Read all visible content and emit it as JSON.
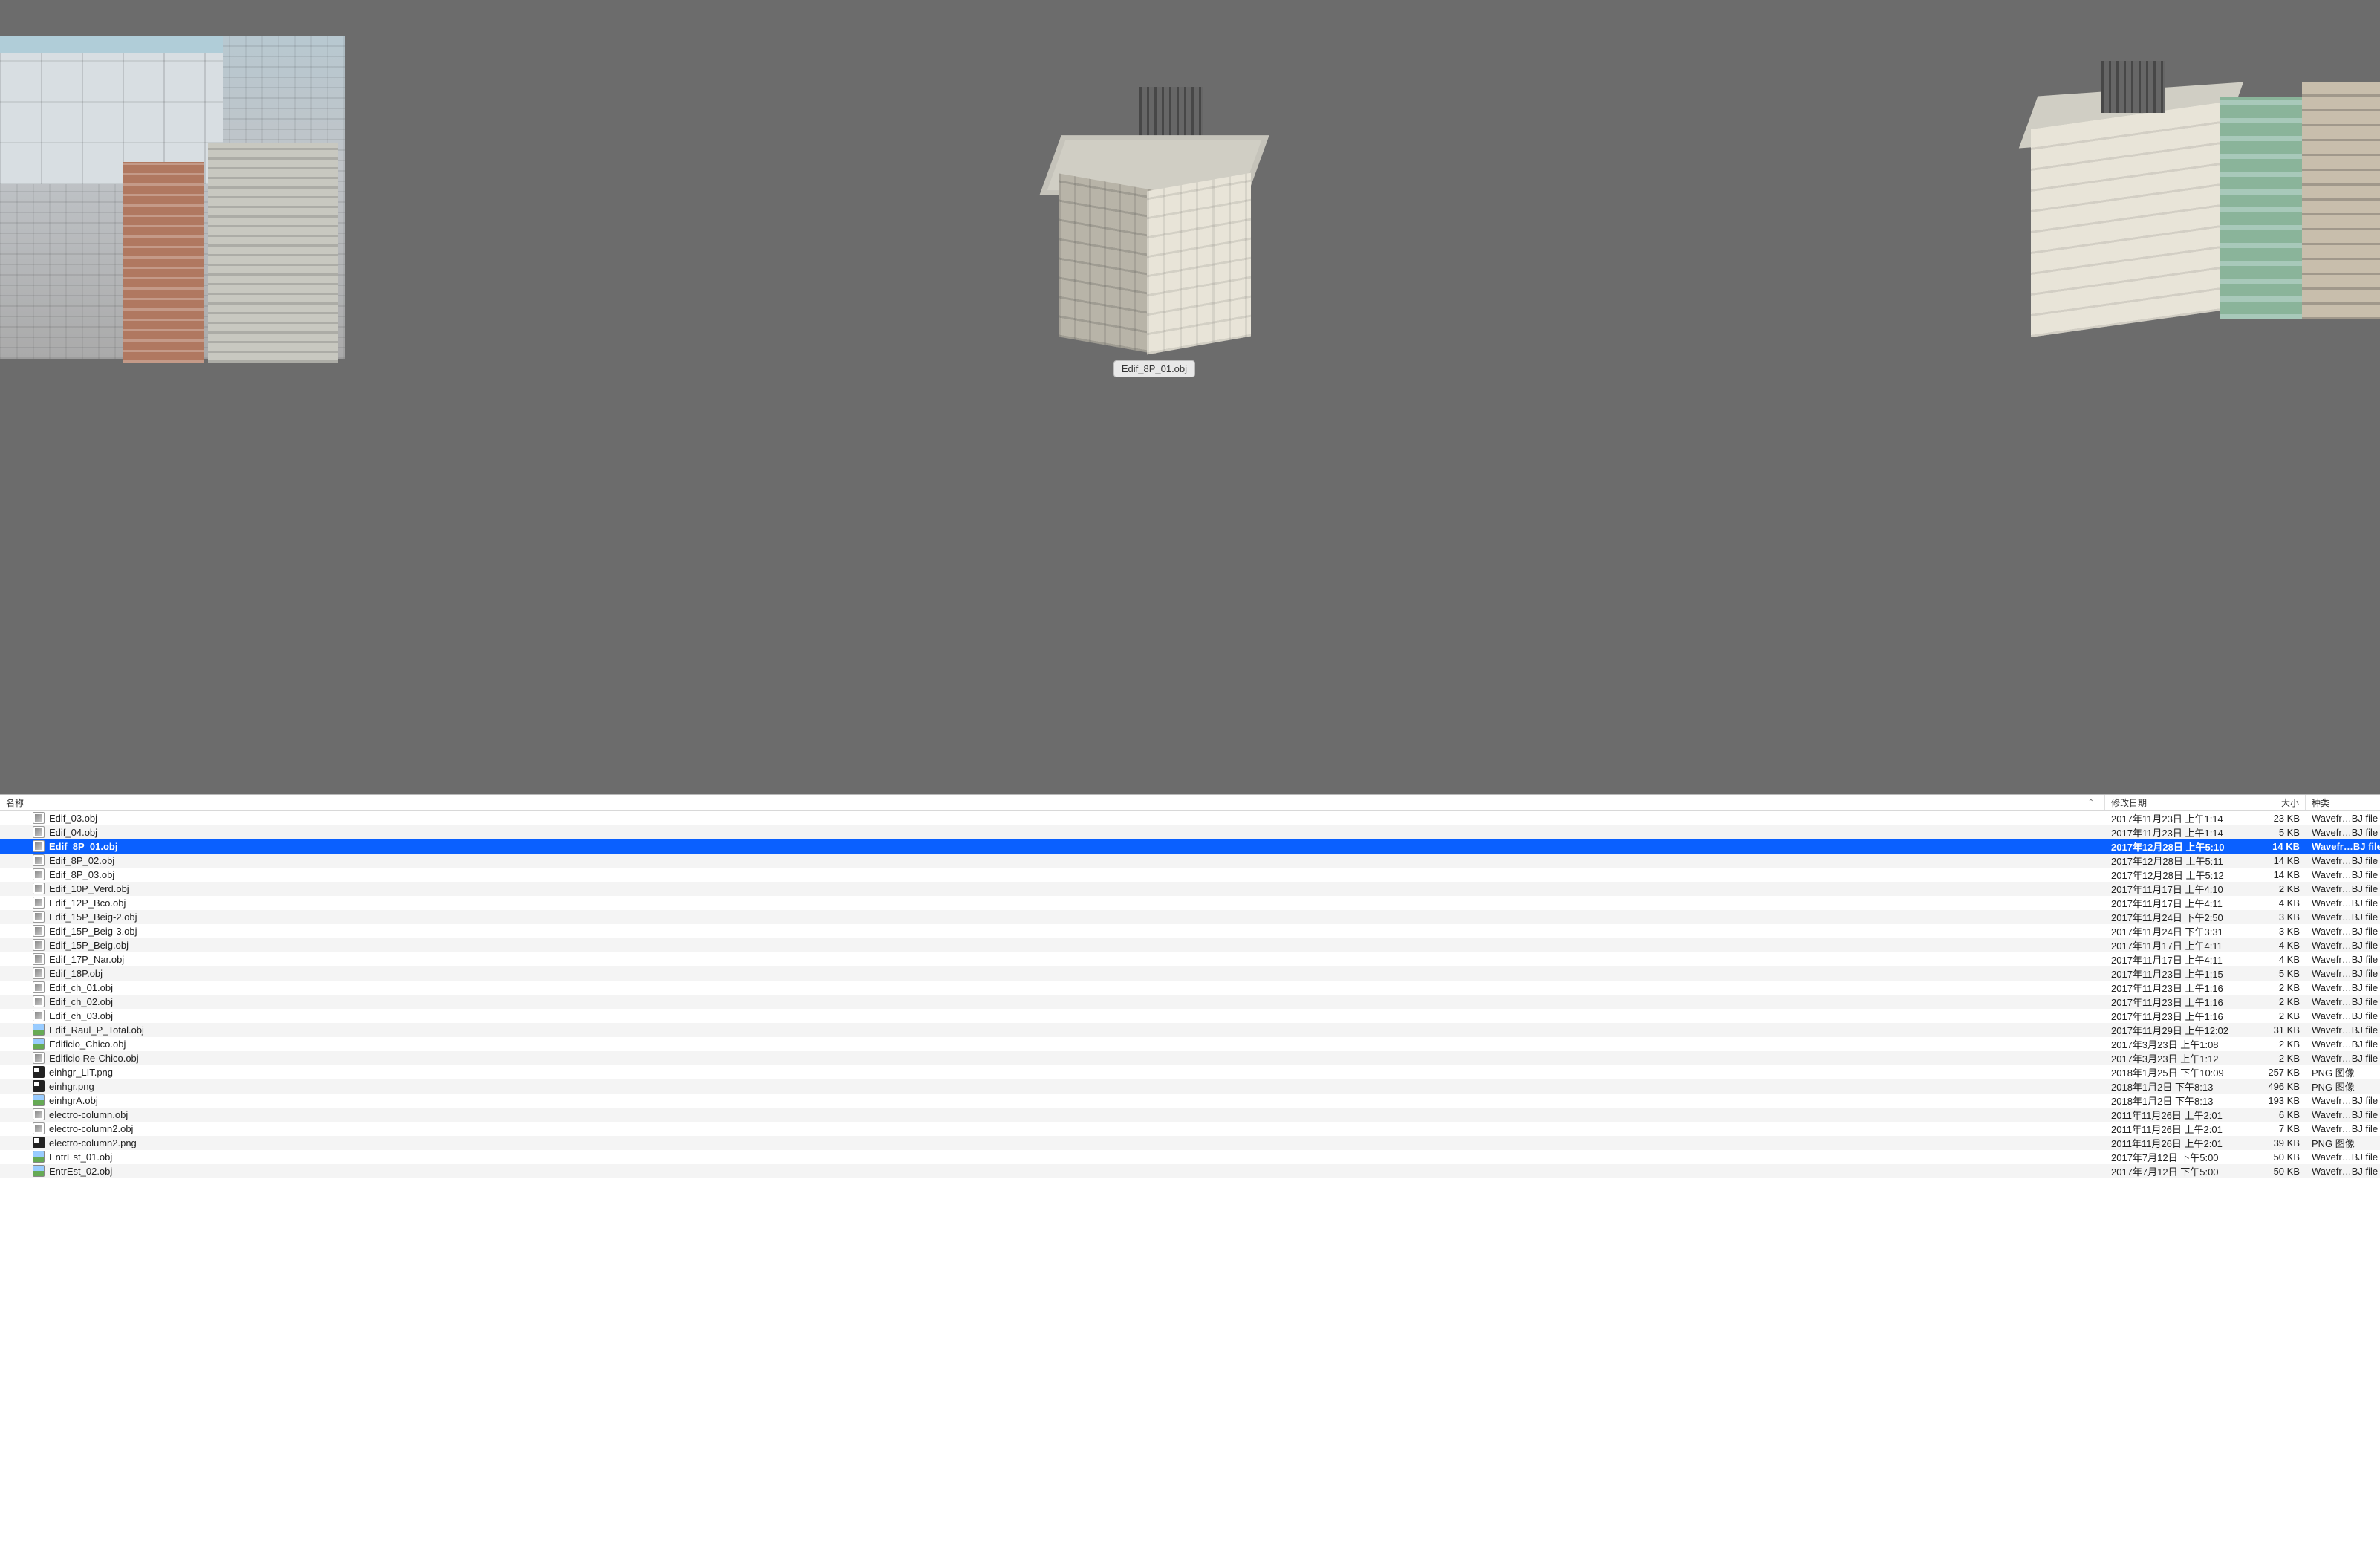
{
  "preview": {
    "selected_label": "Edif_8P_01.obj"
  },
  "columns": {
    "name": "名称",
    "date": "修改日期",
    "size": "大小",
    "kind": "种类"
  },
  "files": [
    {
      "name": "Edif_03.obj",
      "date": "2017年11月23日 上午1:14",
      "size": "23 KB",
      "kind": "Wavefr…BJ file",
      "icon": "obj",
      "selected": false
    },
    {
      "name": "Edif_04.obj",
      "date": "2017年11月23日 上午1:14",
      "size": "5 KB",
      "kind": "Wavefr…BJ file",
      "icon": "obj",
      "selected": false
    },
    {
      "name": "Edif_8P_01.obj",
      "date": "2017年12月28日 上午5:10",
      "size": "14 KB",
      "kind": "Wavefr…BJ file",
      "icon": "obj",
      "selected": true
    },
    {
      "name": "Edif_8P_02.obj",
      "date": "2017年12月28日 上午5:11",
      "size": "14 KB",
      "kind": "Wavefr…BJ file",
      "icon": "obj",
      "selected": false
    },
    {
      "name": "Edif_8P_03.obj",
      "date": "2017年12月28日 上午5:12",
      "size": "14 KB",
      "kind": "Wavefr…BJ file",
      "icon": "obj",
      "selected": false
    },
    {
      "name": "Edif_10P_Verd.obj",
      "date": "2017年11月17日 上午4:10",
      "size": "2 KB",
      "kind": "Wavefr…BJ file",
      "icon": "obj",
      "selected": false
    },
    {
      "name": "Edif_12P_Bco.obj",
      "date": "2017年11月17日 上午4:11",
      "size": "4 KB",
      "kind": "Wavefr…BJ file",
      "icon": "obj",
      "selected": false
    },
    {
      "name": "Edif_15P_Beig-2.obj",
      "date": "2017年11月24日 下午2:50",
      "size": "3 KB",
      "kind": "Wavefr…BJ file",
      "icon": "obj",
      "selected": false
    },
    {
      "name": "Edif_15P_Beig-3.obj",
      "date": "2017年11月24日 下午3:31",
      "size": "3 KB",
      "kind": "Wavefr…BJ file",
      "icon": "obj",
      "selected": false
    },
    {
      "name": "Edif_15P_Beig.obj",
      "date": "2017年11月17日 上午4:11",
      "size": "4 KB",
      "kind": "Wavefr…BJ file",
      "icon": "obj",
      "selected": false
    },
    {
      "name": "Edif_17P_Nar.obj",
      "date": "2017年11月17日 上午4:11",
      "size": "4 KB",
      "kind": "Wavefr…BJ file",
      "icon": "obj",
      "selected": false
    },
    {
      "name": "Edif_18P.obj",
      "date": "2017年11月23日 上午1:15",
      "size": "5 KB",
      "kind": "Wavefr…BJ file",
      "icon": "obj",
      "selected": false
    },
    {
      "name": "Edif_ch_01.obj",
      "date": "2017年11月23日 上午1:16",
      "size": "2 KB",
      "kind": "Wavefr…BJ file",
      "icon": "obj",
      "selected": false
    },
    {
      "name": "Edif_ch_02.obj",
      "date": "2017年11月23日 上午1:16",
      "size": "2 KB",
      "kind": "Wavefr…BJ file",
      "icon": "obj",
      "selected": false
    },
    {
      "name": "Edif_ch_03.obj",
      "date": "2017年11月23日 上午1:16",
      "size": "2 KB",
      "kind": "Wavefr…BJ file",
      "icon": "obj",
      "selected": false
    },
    {
      "name": "Edif_Raul_P_Total.obj",
      "date": "2017年11月29日 上午12:02",
      "size": "31 KB",
      "kind": "Wavefr…BJ file",
      "icon": "img",
      "selected": false
    },
    {
      "name": "Edificio_Chico.obj",
      "date": "2017年3月23日 上午1:08",
      "size": "2 KB",
      "kind": "Wavefr…BJ file",
      "icon": "img",
      "selected": false
    },
    {
      "name": "Edificio Re-Chico.obj",
      "date": "2017年3月23日 上午1:12",
      "size": "2 KB",
      "kind": "Wavefr…BJ file",
      "icon": "obj",
      "selected": false
    },
    {
      "name": "einhgr_LIT.png",
      "date": "2018年1月25日 下午10:09",
      "size": "257 KB",
      "kind": "PNG 图像",
      "icon": "png",
      "selected": false
    },
    {
      "name": "einhgr.png",
      "date": "2018年1月2日 下午8:13",
      "size": "496 KB",
      "kind": "PNG 图像",
      "icon": "png",
      "selected": false
    },
    {
      "name": "einhgrA.obj",
      "date": "2018年1月2日 下午8:13",
      "size": "193 KB",
      "kind": "Wavefr…BJ file",
      "icon": "img",
      "selected": false
    },
    {
      "name": "electro-column.obj",
      "date": "2011年11月26日 上午2:01",
      "size": "6 KB",
      "kind": "Wavefr…BJ file",
      "icon": "obj",
      "selected": false
    },
    {
      "name": "electro-column2.obj",
      "date": "2011年11月26日 上午2:01",
      "size": "7 KB",
      "kind": "Wavefr…BJ file",
      "icon": "obj",
      "selected": false
    },
    {
      "name": "electro-column2.png",
      "date": "2011年11月26日 上午2:01",
      "size": "39 KB",
      "kind": "PNG 图像",
      "icon": "png",
      "selected": false
    },
    {
      "name": "EntrEst_01.obj",
      "date": "2017年7月12日 下午5:00",
      "size": "50 KB",
      "kind": "Wavefr…BJ file",
      "icon": "img",
      "selected": false
    },
    {
      "name": "EntrEst_02.obj",
      "date": "2017年7月12日 下午5:00",
      "size": "50 KB",
      "kind": "Wavefr…BJ file",
      "icon": "img",
      "selected": false
    }
  ]
}
